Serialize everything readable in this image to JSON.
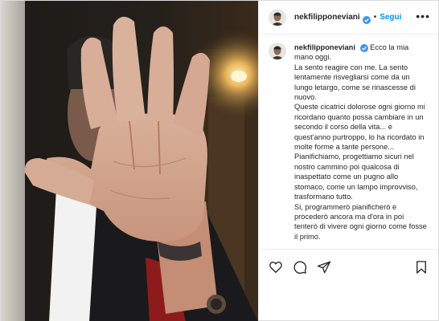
{
  "post": {
    "username": "nekfilipponeviani",
    "follow_label": "Segui",
    "separator": "•",
    "more_label": "•••",
    "caption_first": "Ecco la mia mano oggi.",
    "caption_body": "La sento reagire con me. La sento lentamente risvegliarsi come da un lungo letargo, come se rinascesse di nuovo.\nQueste cicatrici dolorose ogni giorno mi ricordano quanto possa cambiare in un secondo il corso della vita... e quest'anno purtroppo, lo ha ricordato in molte forme a tante persone...\nPianifichiamo, progettiamo sicuri nel nostro cammino poi qualcosa di inaspettato come un pugno allo stomaco, come un lampo improvviso, trasformano tutto.\nSi, programmerò pianificherò e procederò ancora ma d'ora in poi tenterò di vivere ogni giorno come fosse il primo."
  },
  "icons": {
    "verified": "verified-badge-icon",
    "like": "heart-icon",
    "comment": "comment-icon",
    "share": "paper-plane-icon",
    "save": "bookmark-icon"
  },
  "colors": {
    "link_blue": "#0095f6",
    "text": "#262626",
    "border": "#dbdbdb"
  }
}
